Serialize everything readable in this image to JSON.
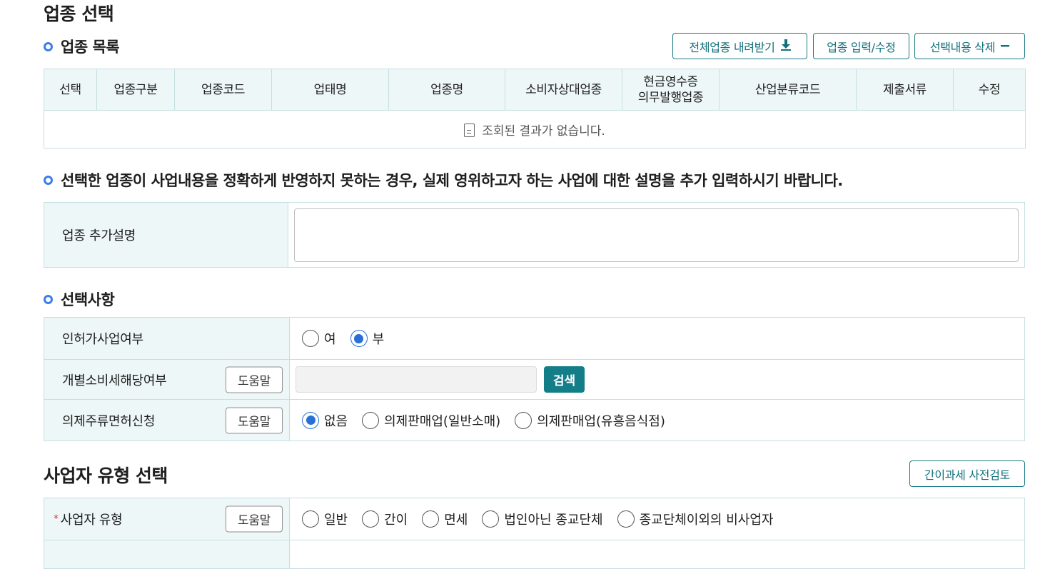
{
  "page_title": "업종 선택",
  "industry_list": {
    "title": "업종 목록",
    "buttons": {
      "download_all": "전체업종 내려받기",
      "input_edit": "업종 입력/수정",
      "delete_selected": "선택내용 삭제"
    },
    "columns": [
      "선택",
      "업종구분",
      "업종코드",
      "업태명",
      "업종명",
      "소비자상대업종",
      "현금영수증\n의무발행업종",
      "산업분류코드",
      "제출서류",
      "수정"
    ],
    "empty_message": "조회된 결과가 없습니다."
  },
  "additional_desc": {
    "title": "선택한 업종이 사업내용을 정확하게 반영하지 못하는 경우, 실제 영위하고자 하는 사업에 대한 설명을 추가 입력하시기 바랍니다.",
    "label": "업종 추가설명",
    "value": ""
  },
  "options": {
    "title": "선택사항",
    "permit_label": "인허가사업여부",
    "permit_yes": "여",
    "permit_no": "부",
    "excise_label": "개별소비세해당여부",
    "help": "도움말",
    "search": "검색",
    "liquor_label": "의제주류면허신청",
    "liquor_none": "없음",
    "liquor_retail": "의제판매업(일반소매)",
    "liquor_bar": "의제판매업(유흥음식점)"
  },
  "biz_type": {
    "title": "사업자 유형 선택",
    "precheck_button": "간이과세 사전검토",
    "required_mark": "*",
    "type_label": "사업자 유형",
    "help": "도움말",
    "type_general": "일반",
    "type_simple": "간이",
    "type_exempt": "면세",
    "type_religious_nonprofit": "법인아닌 종교단체",
    "type_other_nonbiz": "종교단체이외의 비사업자"
  }
}
